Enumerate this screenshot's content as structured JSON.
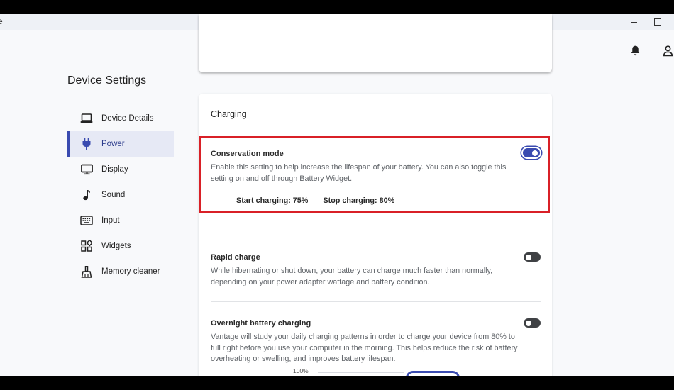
{
  "window": {
    "title": "e"
  },
  "settings_title": "Device Settings",
  "nav": {
    "items": [
      {
        "label": "Device Details",
        "icon": "laptop-icon"
      },
      {
        "label": "Power",
        "icon": "plug-icon",
        "active": true
      },
      {
        "label": "Display",
        "icon": "monitor-icon"
      },
      {
        "label": "Sound",
        "icon": "music-note-icon"
      },
      {
        "label": "Input",
        "icon": "keyboard-icon"
      },
      {
        "label": "Widgets",
        "icon": "widgets-icon"
      },
      {
        "label": "Memory cleaner",
        "icon": "broom-icon"
      }
    ]
  },
  "charging": {
    "title": "Charging",
    "conservation": {
      "title": "Conservation mode",
      "description": "Enable this setting to help increase the lifespan of your battery. You can also toggle this setting on and off through Battery Widget.",
      "start": "Start charging: 75%",
      "stop": "Stop charging: 80%",
      "enabled": true
    },
    "rapid": {
      "title": "Rapid charge",
      "description": "While hibernating or shut down, your battery can charge much faster than normally, depending on your power adapter wattage and battery condition.",
      "enabled": false
    },
    "overnight": {
      "title": "Overnight battery charging",
      "description": "Vantage will study your daily charging patterns in order to charge your device from 80% to full right before you use your computer in the morning. This helps reduce the risk of battery overheating or swelling, and improves battery lifespan.",
      "enabled": false
    },
    "chart_label": "100%"
  },
  "colors": {
    "accent": "#3a4bb0",
    "highlight": "#d92027"
  }
}
